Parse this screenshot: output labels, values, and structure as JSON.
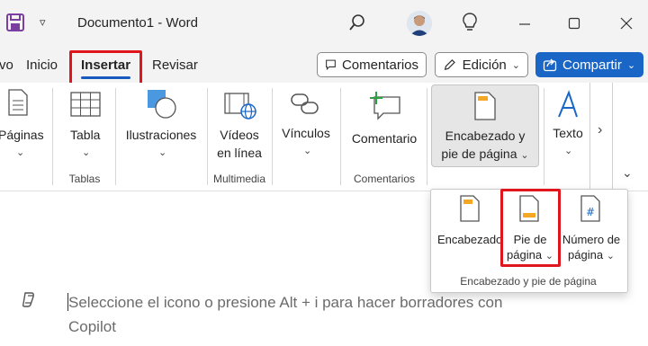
{
  "app": {
    "title": "Documento1  -  Word",
    "accent": "#185abd",
    "highlight": "#e0161c"
  },
  "tabs": [
    {
      "label": "vo"
    },
    {
      "label": "Inicio"
    },
    {
      "label": "Insertar",
      "active": true
    },
    {
      "label": "Revisar"
    }
  ],
  "header_buttons": {
    "comments": "Comentarios",
    "editing": "Edición",
    "share": "Compartir"
  },
  "ribbon": {
    "pages": "Páginas",
    "table": "Tabla",
    "illustrations": "Ilustraciones",
    "videos_line1": "Vídeos",
    "videos_line2": "en línea",
    "links": "Vínculos",
    "comment": "Comentario",
    "header_footer_line1": "Encabezado y",
    "header_footer_line2": "pie de página",
    "text": "Texto",
    "more": "›",
    "groups": {
      "tables": "Tablas",
      "multimedia": "Multimedia",
      "comments": "Comentarios"
    }
  },
  "flyout": {
    "header": "Encabezado",
    "footer_line1": "Pie de",
    "footer_line2": "página",
    "page_number_line1": "Número de",
    "page_number_line2": "página",
    "group_label": "Encabezado y pie de página"
  },
  "document": {
    "copilot_prompt": "Seleccione el icono o presione Alt + i para hacer borradores con Copilot"
  }
}
